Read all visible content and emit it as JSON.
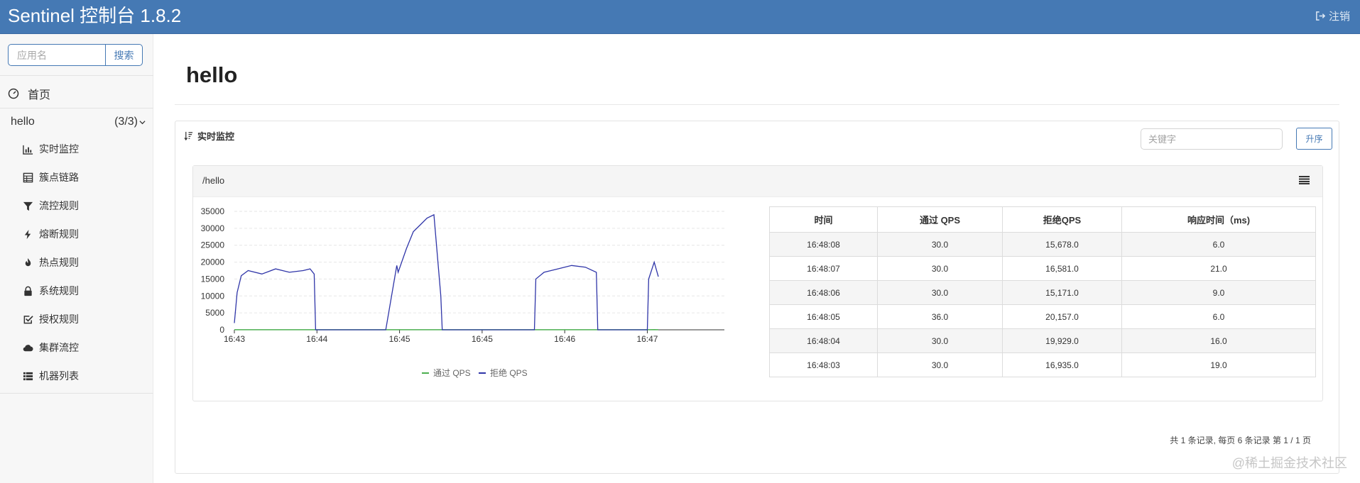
{
  "header": {
    "title": "Sentinel 控制台 1.8.2",
    "logout_label": "注销"
  },
  "sidebar": {
    "search_placeholder": "应用名",
    "search_button": "搜索",
    "home_label": "首页",
    "app": {
      "name": "hello",
      "count": "(3/3)"
    },
    "items": [
      {
        "label": "实时监控",
        "icon": "bar-chart-icon"
      },
      {
        "label": "簇点链路",
        "icon": "table-icon"
      },
      {
        "label": "流控规则",
        "icon": "filter-icon"
      },
      {
        "label": "熔断规则",
        "icon": "bolt-icon"
      },
      {
        "label": "热点规则",
        "icon": "fire-icon"
      },
      {
        "label": "系统规则",
        "icon": "lock-icon"
      },
      {
        "label": "授权规则",
        "icon": "check-square-icon"
      },
      {
        "label": "集群流控",
        "icon": "cloud-icon"
      },
      {
        "label": "机器列表",
        "icon": "list-icon"
      }
    ]
  },
  "main": {
    "title": "hello",
    "panel_title": "实时监控",
    "keyword_placeholder": "关键字",
    "sort_button": "升序",
    "resource": {
      "name": "/hello",
      "legend": [
        "通过 QPS",
        "拒绝 QPS"
      ],
      "table": {
        "headers": [
          "时间",
          "通过 QPS",
          "拒绝QPS",
          "响应时间（ms)"
        ],
        "rows": [
          [
            "16:48:08",
            "30.0",
            "15,678.0",
            "6.0"
          ],
          [
            "16:48:07",
            "30.0",
            "16,581.0",
            "21.0"
          ],
          [
            "16:48:06",
            "30.0",
            "15,171.0",
            "9.0"
          ],
          [
            "16:48:05",
            "36.0",
            "20,157.0",
            "6.0"
          ],
          [
            "16:48:04",
            "30.0",
            "19,929.0",
            "16.0"
          ],
          [
            "16:48:03",
            "30.0",
            "16,935.0",
            "19.0"
          ]
        ]
      }
    },
    "pager": "共 1 条记录, 每页 6 条记录 第 1 / 1 页"
  },
  "watermark": "@稀土掘金技术社区",
  "colors": {
    "header": "#4579b4",
    "pass": "#4caf50",
    "block": "#2f35a8"
  },
  "chart_data": {
    "type": "line",
    "xlabel": "",
    "ylabel": "",
    "ylim": [
      0,
      35000
    ],
    "yticks": [
      "0",
      "5000",
      "10000",
      "15000",
      "20000",
      "25000",
      "30000",
      "35000"
    ],
    "xticks": [
      "16:43",
      "16:44",
      "16:45",
      "16:45",
      "16:46",
      "16:47"
    ],
    "x": [
      "16:43:00",
      "16:43:02",
      "16:43:05",
      "16:43:10",
      "16:43:20",
      "16:43:30",
      "16:43:40",
      "16:43:50",
      "16:43:55",
      "16:43:58",
      "16:43:59",
      "16:44:05",
      "16:44:50",
      "16:44:58",
      "16:44:59",
      "16:45:05",
      "16:45:10",
      "16:45:15",
      "16:45:20",
      "16:45:25",
      "16:45:30",
      "16:45:31",
      "16:45:40",
      "16:46:38",
      "16:46:39",
      "16:46:45",
      "16:46:55",
      "16:47:05",
      "16:47:15",
      "16:47:23",
      "16:47:24",
      "16:48:00",
      "16:48:01",
      "16:48:05",
      "16:48:08"
    ],
    "series": [
      {
        "name": "通过 QPS",
        "values": [
          30,
          30,
          30,
          30,
          30,
          30,
          30,
          30,
          30,
          30,
          30,
          30,
          30,
          30,
          30,
          30,
          30,
          30,
          30,
          30,
          30,
          30,
          30,
          30,
          30,
          30,
          30,
          30,
          30,
          30,
          30,
          30,
          30,
          36,
          30
        ]
      },
      {
        "name": "拒绝 QPS",
        "values": [
          2000,
          11000,
          16000,
          17500,
          16500,
          18000,
          17000,
          17500,
          18000,
          16500,
          0,
          0,
          0,
          19000,
          17000,
          24000,
          29000,
          31000,
          33000,
          34000,
          10000,
          0,
          0,
          0,
          15000,
          17000,
          18000,
          19000,
          18500,
          17000,
          0,
          0,
          15000,
          20000,
          15700
        ]
      }
    ]
  }
}
